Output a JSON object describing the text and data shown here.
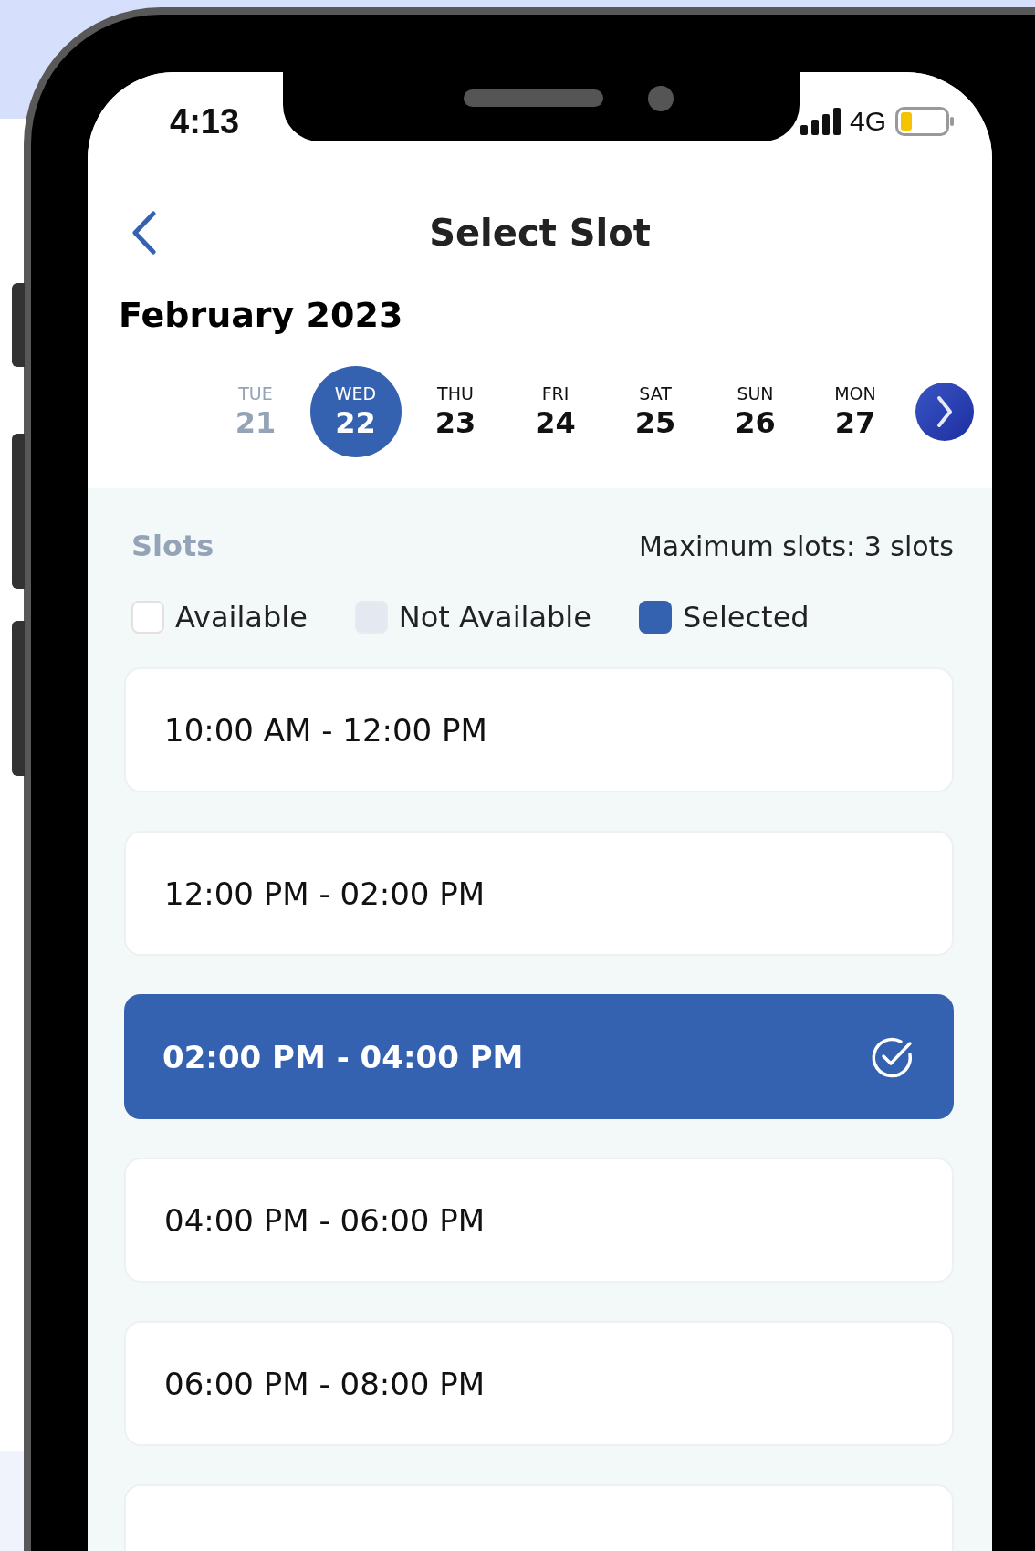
{
  "status_bar": {
    "time": "4:13",
    "network": "4G"
  },
  "header": {
    "title": "Select Slot"
  },
  "month": "February 2023",
  "days": [
    {
      "weekday": "TUE",
      "date": "21",
      "selected": false,
      "disabled": true
    },
    {
      "weekday": "WED",
      "date": "22",
      "selected": true,
      "disabled": false
    },
    {
      "weekday": "THU",
      "date": "23",
      "selected": false,
      "disabled": false
    },
    {
      "weekday": "FRI",
      "date": "24",
      "selected": false,
      "disabled": false
    },
    {
      "weekday": "SAT",
      "date": "25",
      "selected": false,
      "disabled": false
    },
    {
      "weekday": "SUN",
      "date": "26",
      "selected": false,
      "disabled": false
    },
    {
      "weekday": "MON",
      "date": "27",
      "selected": false,
      "disabled": false
    }
  ],
  "slots_section": {
    "title": "Slots",
    "limit": "Maximum slots: 3 slots"
  },
  "legend": [
    {
      "kind": "available",
      "label": "Available"
    },
    {
      "kind": "not_available",
      "label": "Not Available"
    },
    {
      "kind": "selected",
      "label": "Selected"
    }
  ],
  "slots": [
    {
      "time": "10:00 AM - 12:00 PM",
      "selected": false
    },
    {
      "time": "12:00 PM - 02:00 PM",
      "selected": false
    },
    {
      "time": "02:00 PM - 04:00 PM",
      "selected": true
    },
    {
      "time": "04:00 PM - 06:00 PM",
      "selected": false
    },
    {
      "time": "06:00 PM - 08:00 PM",
      "selected": false
    }
  ]
}
